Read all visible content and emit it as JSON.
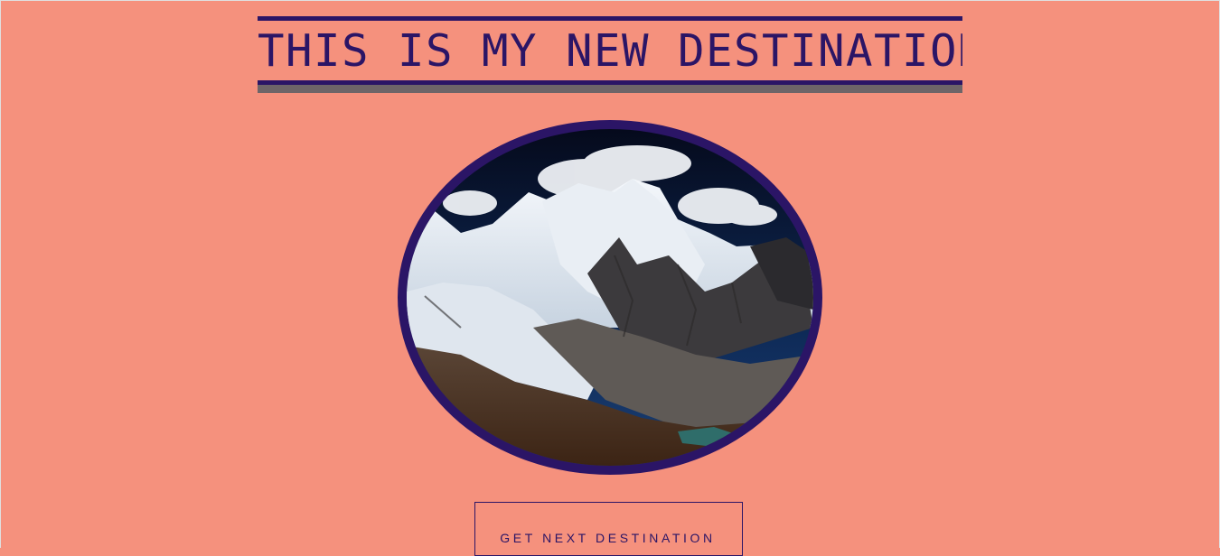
{
  "header": {
    "title": "THIS IS MY NEW DESTINATION"
  },
  "destination_image": {
    "subject": "snow-capped mountain range"
  },
  "actions": {
    "next_label": "GET NEXT DESTINATION"
  },
  "colors": {
    "background": "#f5917d",
    "accent": "#2b1566",
    "gray_bar": "#6e6568"
  }
}
